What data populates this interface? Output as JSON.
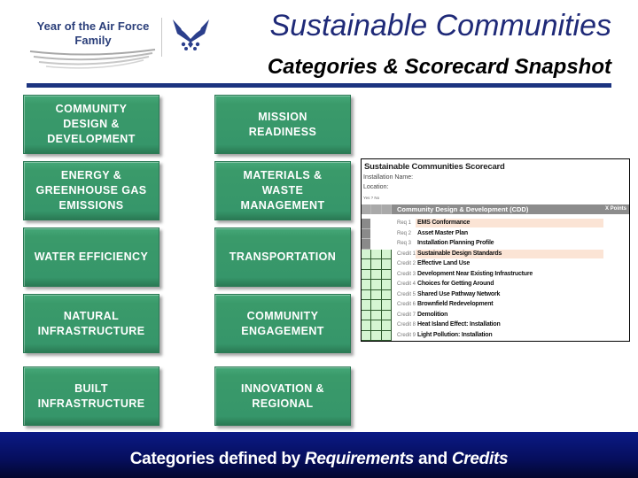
{
  "header": {
    "logo_text": "Year of the Air Force\nFamily",
    "title": "Sustainable Communities",
    "subtitle": "Categories & Scorecard Snapshot",
    "icons": [
      "swoosh-lines",
      "air-force-emblem"
    ],
    "colors": {
      "title": "#1f2a78",
      "rule": "#1c3480",
      "tile": "#389a6c"
    }
  },
  "categories": [
    {
      "label": "COMMUNITY\nDESIGN &\nDEVELOPMENT"
    },
    {
      "label": "MISSION\nREADINESS"
    },
    {
      "label": "ENERGY &\nGREENHOUSE GAS\nEMISSIONS"
    },
    {
      "label": "MATERIALS &\nWASTE\nMANAGEMENT"
    },
    {
      "label": "WATER EFFICIENCY"
    },
    {
      "label": "TRANSPORTATION"
    },
    {
      "label": "NATURAL\nINFRASTRUCTURE"
    },
    {
      "label": "COMMUNITY\nENGAGEMENT"
    },
    {
      "label": "BUILT\nINFRASTRUCTURE"
    },
    {
      "label": "INNOVATION &\nREGIONAL"
    }
  ],
  "scorecard": {
    "title": "Sustainable Communities Scorecard",
    "installation_label": "Installation Name:",
    "location_label": "Location:",
    "column_header": "Yes   ?   No",
    "category": "Community Design & Development (CDD)",
    "points_label": "X Points",
    "rows": [
      {
        "code": "Req 1",
        "name": "EMS Conformance",
        "type": "req",
        "highlight": true
      },
      {
        "code": "Req 2",
        "name": "Asset Master Plan",
        "type": "req",
        "highlight": false
      },
      {
        "code": "Req 3",
        "name": "Installation Planning Profile",
        "type": "req",
        "highlight": false
      },
      {
        "code": "Credit 1",
        "name": "Sustainable Design Standards",
        "type": "credit",
        "highlight": true
      },
      {
        "code": "Credit 2",
        "name": "Effective Land Use",
        "type": "credit",
        "highlight": false
      },
      {
        "code": "Credit 3",
        "name": "Development Near Existing Infrastructure",
        "type": "credit",
        "highlight": false
      },
      {
        "code": "Credit 4",
        "name": "Choices for Getting Around",
        "type": "credit",
        "highlight": false
      },
      {
        "code": "Credit 5",
        "name": "Shared Use Pathway Network",
        "type": "credit",
        "highlight": false
      },
      {
        "code": "Credit 6",
        "name": "Brownfield Redevelopment",
        "type": "credit",
        "highlight": false
      },
      {
        "code": "Credit 7",
        "name": "Demolition",
        "type": "credit",
        "highlight": false
      },
      {
        "code": "Credit 8",
        "name": "Heat Island Effect: Installation",
        "type": "credit",
        "highlight": false
      },
      {
        "code": "Credit 9",
        "name": "Light Pollution: Installation",
        "type": "credit",
        "highlight": false
      }
    ]
  },
  "footer": {
    "text_1": "Categories defined by ",
    "text_2": "Requirements",
    "text_3": " and ",
    "text_4": "Credits"
  }
}
